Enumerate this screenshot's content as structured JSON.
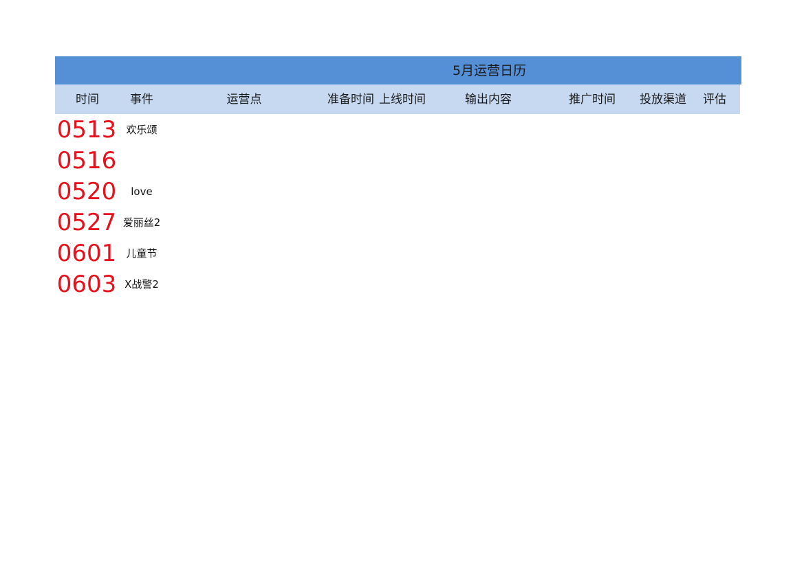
{
  "sheet": {
    "title": "5月运营日历",
    "headers": [
      "时间",
      "事件",
      "运营点",
      "准备时间",
      "上线时间",
      "输出内容",
      "推广时间",
      "投放渠道",
      "评估"
    ],
    "rows": [
      {
        "date": "0513",
        "event": "欢乐颂"
      },
      {
        "date": "0516",
        "event": ""
      },
      {
        "date": "0520",
        "event": "love"
      },
      {
        "date": "0527",
        "event": "爱丽丝2"
      },
      {
        "date": "0601",
        "event": "儿童节"
      },
      {
        "date": "0603",
        "event": "X战警2"
      }
    ]
  },
  "colors": {
    "title_bar": "#5590d7",
    "header_bar": "#c6d9f1",
    "date_text": "#e8101a"
  }
}
